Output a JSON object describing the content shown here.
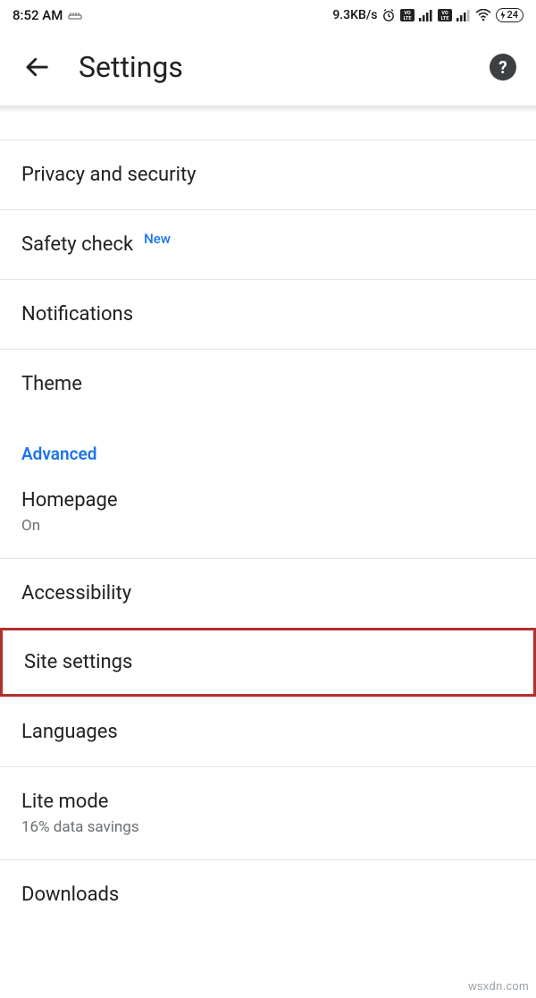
{
  "status": {
    "time": "8:52 AM",
    "speed": "9.3KB/s",
    "battery": "24"
  },
  "header": {
    "title": "Settings"
  },
  "items": {
    "privacy": {
      "label": "Privacy and security"
    },
    "safety": {
      "label": "Safety check",
      "badge": "New"
    },
    "notifications": {
      "label": "Notifications"
    },
    "theme": {
      "label": "Theme"
    }
  },
  "section": {
    "advanced": "Advanced"
  },
  "adv": {
    "homepage": {
      "label": "Homepage",
      "sub": "On"
    },
    "accessibility": {
      "label": "Accessibility"
    },
    "siteSettings": {
      "label": "Site settings"
    },
    "languages": {
      "label": "Languages"
    },
    "lite": {
      "label": "Lite mode",
      "sub": "16% data savings"
    },
    "downloads": {
      "label": "Downloads"
    }
  },
  "watermark": "wsxdn.com"
}
